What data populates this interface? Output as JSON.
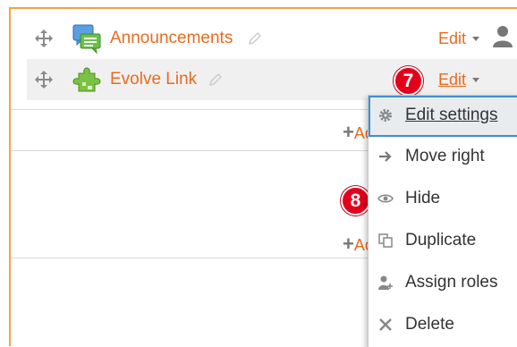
{
  "activities": [
    {
      "name": "Announcements",
      "icon": "forum-icon",
      "edit_label": "Edit"
    },
    {
      "name": "Evolve Link",
      "icon": "puzzle-plugin-icon",
      "edit_label": "Edit"
    }
  ],
  "add_link_text": "Add an activity or resource",
  "badges": {
    "edit_step": "7",
    "hide_step": "8"
  },
  "edit_menu": {
    "items": [
      {
        "label": "Edit settings",
        "icon": "gear-icon"
      },
      {
        "label": "Move right",
        "icon": "arrow-right-icon"
      },
      {
        "label": "Hide",
        "icon": "eye-icon"
      },
      {
        "label": "Duplicate",
        "icon": "duplicate-icon"
      },
      {
        "label": "Assign roles",
        "icon": "assign-roles-icon"
      },
      {
        "label": "Delete",
        "icon": "delete-x-icon"
      }
    ]
  },
  "colors": {
    "link": "#e86b1f",
    "frame": "#f6a345",
    "badge": "#e3001b",
    "menu_focus": "#3b8fd6"
  }
}
